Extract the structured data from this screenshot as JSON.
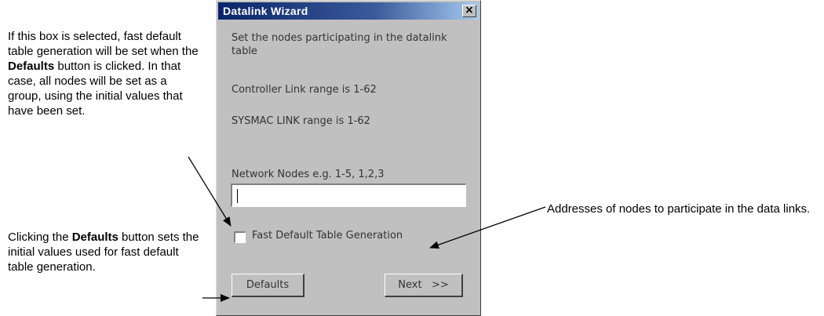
{
  "annotations": {
    "fast_note": {
      "p1": "If this box is selected, fast default table generation will be set when the ",
      "b1": "Defaults",
      "p2": " button is clicked. In that case, all nodes will be set as a group, using the initial values that have been set."
    },
    "defaults_note": {
      "p1": "Clicking the ",
      "b1": "Defaults",
      "p2": " button sets the initial values used for fast default table generation."
    },
    "nodes_note": "Addresses of nodes to participate in the data links."
  },
  "dialog": {
    "title": "Datalink Wizard",
    "close_label": "×",
    "instruction": "Set the nodes participating in the datalink table",
    "controller_link_range": "Controller Link range is 1-62",
    "sysmac_link_range": "SYSMAC LINK range is 1-62",
    "network_nodes_label": "Network Nodes  e.g. 1-5, 1,2,3",
    "network_nodes_value": "",
    "fast_default_label": "Fast Default Table Generation",
    "fast_default_checked": false,
    "defaults_button": "Defaults",
    "next_button": "Next   >>"
  }
}
